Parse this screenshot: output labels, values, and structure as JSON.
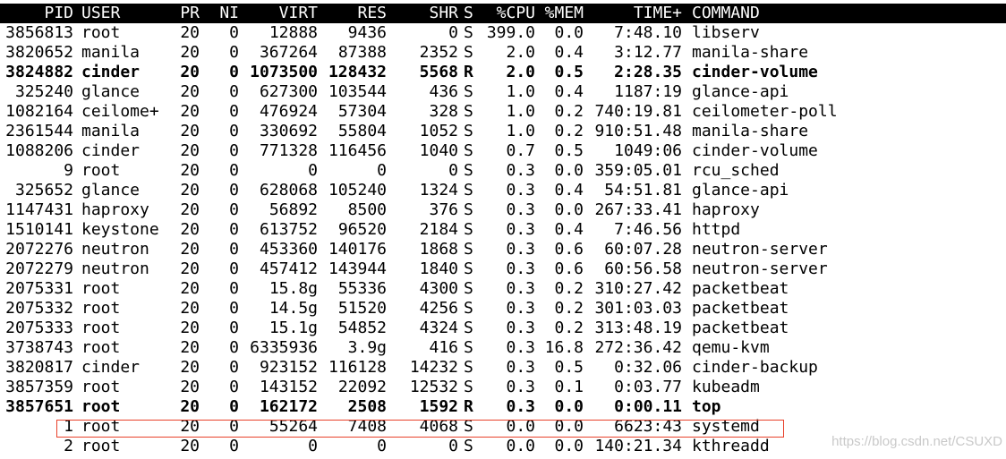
{
  "columns": [
    "PID",
    "USER",
    "PR",
    "NI",
    "VIRT",
    "RES",
    "SHR",
    "S",
    "%CPU",
    "%MEM",
    "TIME+",
    "COMMAND"
  ],
  "processes": [
    {
      "pid": "3856813",
      "user": "root",
      "pr": "20",
      "ni": "0",
      "virt": "12888",
      "res": "9436",
      "shr": "0",
      "s": "S",
      "cpu": "399.0",
      "mem": "0.0",
      "time": "7:48.10",
      "command": "libserv",
      "bold": false
    },
    {
      "pid": "3820652",
      "user": "manila",
      "pr": "20",
      "ni": "0",
      "virt": "367264",
      "res": "87388",
      "shr": "2352",
      "s": "S",
      "cpu": "2.0",
      "mem": "0.4",
      "time": "3:12.77",
      "command": "manila-share",
      "bold": false
    },
    {
      "pid": "3824882",
      "user": "cinder",
      "pr": "20",
      "ni": "0",
      "virt": "1073500",
      "res": "128432",
      "shr": "5568",
      "s": "R",
      "cpu": "2.0",
      "mem": "0.5",
      "time": "2:28.35",
      "command": "cinder-volume",
      "bold": true
    },
    {
      "pid": "325240",
      "user": "glance",
      "pr": "20",
      "ni": "0",
      "virt": "627300",
      "res": "103544",
      "shr": "436",
      "s": "S",
      "cpu": "1.0",
      "mem": "0.4",
      "time": "1187:19",
      "command": "glance-api",
      "bold": false
    },
    {
      "pid": "1082164",
      "user": "ceilome+",
      "pr": "20",
      "ni": "0",
      "virt": "476924",
      "res": "57304",
      "shr": "328",
      "s": "S",
      "cpu": "1.0",
      "mem": "0.2",
      "time": "740:19.81",
      "command": "ceilometer-poll",
      "bold": false
    },
    {
      "pid": "2361544",
      "user": "manila",
      "pr": "20",
      "ni": "0",
      "virt": "330692",
      "res": "55804",
      "shr": "1052",
      "s": "S",
      "cpu": "1.0",
      "mem": "0.2",
      "time": "910:51.48",
      "command": "manila-share",
      "bold": false
    },
    {
      "pid": "1088206",
      "user": "cinder",
      "pr": "20",
      "ni": "0",
      "virt": "771328",
      "res": "116456",
      "shr": "1040",
      "s": "S",
      "cpu": "0.7",
      "mem": "0.5",
      "time": "1049:06",
      "command": "cinder-volume",
      "bold": false
    },
    {
      "pid": "9",
      "user": "root",
      "pr": "20",
      "ni": "0",
      "virt": "0",
      "res": "0",
      "shr": "0",
      "s": "S",
      "cpu": "0.3",
      "mem": "0.0",
      "time": "359:05.01",
      "command": "rcu_sched",
      "bold": false
    },
    {
      "pid": "325652",
      "user": "glance",
      "pr": "20",
      "ni": "0",
      "virt": "628068",
      "res": "105240",
      "shr": "1324",
      "s": "S",
      "cpu": "0.3",
      "mem": "0.4",
      "time": "54:51.81",
      "command": "glance-api",
      "bold": false
    },
    {
      "pid": "1147431",
      "user": "haproxy",
      "pr": "20",
      "ni": "0",
      "virt": "56892",
      "res": "8500",
      "shr": "376",
      "s": "S",
      "cpu": "0.3",
      "mem": "0.0",
      "time": "267:33.41",
      "command": "haproxy",
      "bold": false
    },
    {
      "pid": "1510141",
      "user": "keystone",
      "pr": "20",
      "ni": "0",
      "virt": "613752",
      "res": "96520",
      "shr": "2184",
      "s": "S",
      "cpu": "0.3",
      "mem": "0.4",
      "time": "7:46.56",
      "command": "httpd",
      "bold": false
    },
    {
      "pid": "2072276",
      "user": "neutron",
      "pr": "20",
      "ni": "0",
      "virt": "453360",
      "res": "140176",
      "shr": "1868",
      "s": "S",
      "cpu": "0.3",
      "mem": "0.6",
      "time": "60:07.28",
      "command": "neutron-server",
      "bold": false
    },
    {
      "pid": "2072279",
      "user": "neutron",
      "pr": "20",
      "ni": "0",
      "virt": "457412",
      "res": "143944",
      "shr": "1840",
      "s": "S",
      "cpu": "0.3",
      "mem": "0.6",
      "time": "60:56.58",
      "command": "neutron-server",
      "bold": false
    },
    {
      "pid": "2075331",
      "user": "root",
      "pr": "20",
      "ni": "0",
      "virt": "15.8g",
      "res": "55336",
      "shr": "4300",
      "s": "S",
      "cpu": "0.3",
      "mem": "0.2",
      "time": "310:27.42",
      "command": "packetbeat",
      "bold": false
    },
    {
      "pid": "2075332",
      "user": "root",
      "pr": "20",
      "ni": "0",
      "virt": "14.5g",
      "res": "51520",
      "shr": "4256",
      "s": "S",
      "cpu": "0.3",
      "mem": "0.2",
      "time": "301:03.03",
      "command": "packetbeat",
      "bold": false
    },
    {
      "pid": "2075333",
      "user": "root",
      "pr": "20",
      "ni": "0",
      "virt": "15.1g",
      "res": "54852",
      "shr": "4324",
      "s": "S",
      "cpu": "0.3",
      "mem": "0.2",
      "time": "313:48.19",
      "command": "packetbeat",
      "bold": false
    },
    {
      "pid": "3738743",
      "user": "root",
      "pr": "20",
      "ni": "0",
      "virt": "6335936",
      "res": "3.9g",
      "shr": "416",
      "s": "S",
      "cpu": "0.3",
      "mem": "16.8",
      "time": "272:36.42",
      "command": "qemu-kvm",
      "bold": false
    },
    {
      "pid": "3820817",
      "user": "cinder",
      "pr": "20",
      "ni": "0",
      "virt": "923152",
      "res": "116128",
      "shr": "14232",
      "s": "S",
      "cpu": "0.3",
      "mem": "0.5",
      "time": "0:32.06",
      "command": "cinder-backup",
      "bold": false
    },
    {
      "pid": "3857359",
      "user": "root",
      "pr": "20",
      "ni": "0",
      "virt": "143152",
      "res": "22092",
      "shr": "12532",
      "s": "S",
      "cpu": "0.3",
      "mem": "0.1",
      "time": "0:03.77",
      "command": "kubeadm",
      "bold": false
    },
    {
      "pid": "3857651",
      "user": "root",
      "pr": "20",
      "ni": "0",
      "virt": "162172",
      "res": "2508",
      "shr": "1592",
      "s": "R",
      "cpu": "0.3",
      "mem": "0.0",
      "time": "0:00.11",
      "command": "top",
      "bold": true
    },
    {
      "pid": "1",
      "user": "root",
      "pr": "20",
      "ni": "0",
      "virt": "55264",
      "res": "7408",
      "shr": "4068",
      "s": "S",
      "cpu": "0.0",
      "mem": "0.0",
      "time": "6623:43",
      "command": "systemd",
      "bold": false
    },
    {
      "pid": "2",
      "user": "root",
      "pr": "20",
      "ni": "0",
      "virt": "0",
      "res": "0",
      "shr": "0",
      "s": "S",
      "cpu": "0.0",
      "mem": "0.0",
      "time": "140:21.34",
      "command": "kthreadd",
      "bold": false
    }
  ],
  "highlighted_pid": "1",
  "watermark": "https://blog.csdn.net/CSUXD",
  "colors": {
    "background": "#ffffff",
    "foreground": "#000000",
    "header_bg": "#000000",
    "header_fg": "#ffffff",
    "highlight_border": "#e8402a",
    "watermark": "#c9c9c9"
  }
}
